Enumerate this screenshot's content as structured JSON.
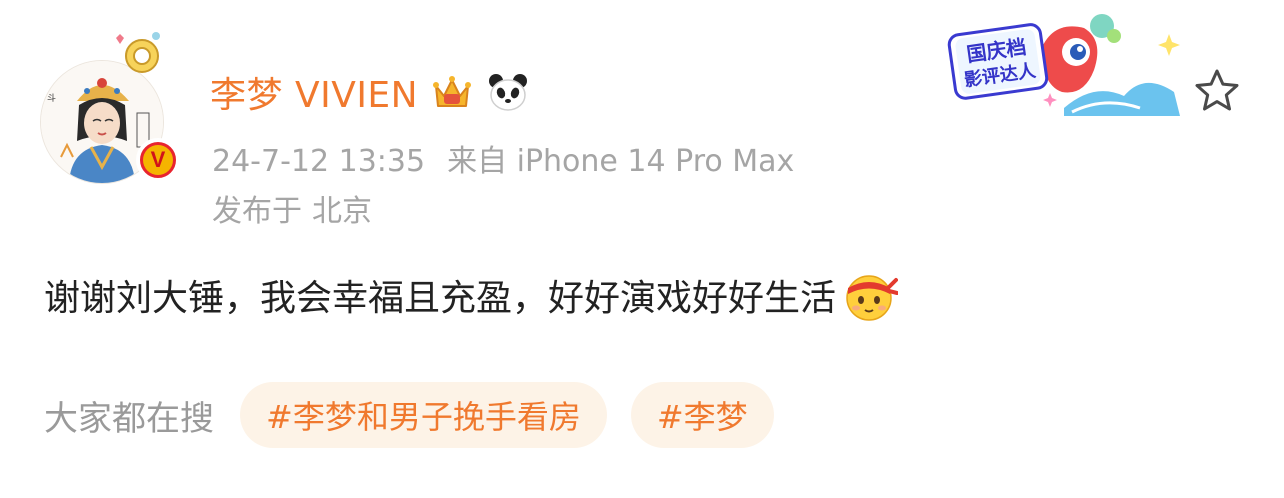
{
  "user": {
    "name": "李梦 VIVIEN",
    "verified_mark": "V"
  },
  "meta": {
    "timestamp": "24-7-12 13:35",
    "source": "来自 iPhone 14 Pro Max",
    "location_prefix": "发布于",
    "location": "北京"
  },
  "event_badge": {
    "line1": "国庆档",
    "line2": "影评达人"
  },
  "post": {
    "text": "谢谢刘大锤，我会幸福且充盈，好好演戏好好生活"
  },
  "search": {
    "label": "大家都在搜",
    "tags": [
      "#李梦和男子挽手看房",
      "#李梦"
    ]
  },
  "colors": {
    "accent_orange": "#f0792e",
    "tag_background": "#fdf3e7",
    "meta_gray": "#a5a5a5",
    "verified_red": "#e8242e"
  }
}
